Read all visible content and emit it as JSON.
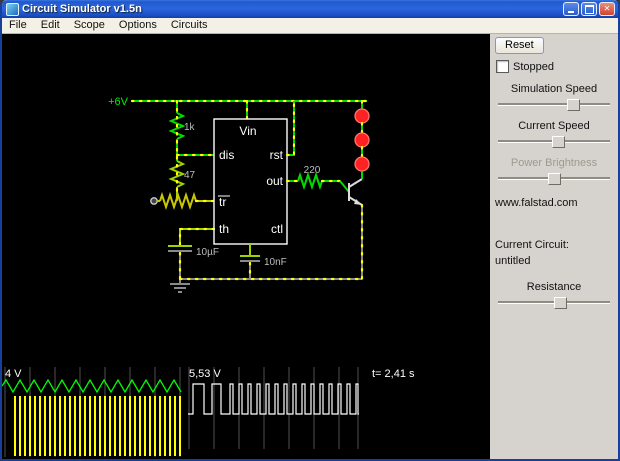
{
  "window": {
    "title": "Circuit Simulator v1.5n"
  },
  "menu": {
    "items": [
      {
        "label": "File"
      },
      {
        "label": "Edit"
      },
      {
        "label": "Scope"
      },
      {
        "label": "Options"
      },
      {
        "label": "Circuits"
      }
    ]
  },
  "panel": {
    "reset_label": "Reset",
    "stopped_label": "Stopped",
    "simulation_speed_label": "Simulation Speed",
    "current_speed_label": "Current Speed",
    "power_brightness_label": "Power Brightness",
    "website": "www.falstad.com",
    "current_circuit_label": "Current Circuit:",
    "current_circuit_value": "untitled",
    "resistance_label": "Resistance"
  },
  "circuit": {
    "labels": {
      "supply": "+6V",
      "r1": "1k",
      "r2": "47",
      "r3": "220",
      "c1": "10µF",
      "c2": "10nF",
      "pin_vin": "Vin",
      "pin_dis": "dis",
      "pin_rst": "rst",
      "pin_tr": "tr",
      "pin_out": "out",
      "pin_th": "th",
      "pin_ctl": "ctl"
    },
    "colors": {
      "wire_active": "#00dd00",
      "wire_mid": "#9ed300",
      "wire_neutral": "#8a8a8a",
      "current_dot": "#ffff00",
      "led_on": "#ff2222"
    }
  },
  "scope": {
    "left_voltage": "4 V",
    "right_voltage": "5,53 V",
    "time": "t= 2,41 s"
  }
}
